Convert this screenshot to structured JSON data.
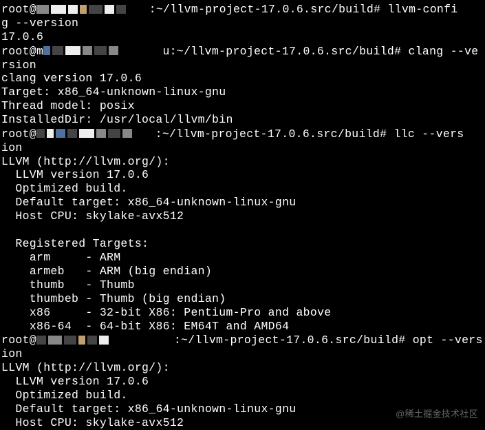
{
  "lines": {
    "l1a": "root@",
    "l1b": ":~/llvm-project-17.0.6.src/build# llvm-confi",
    "l2": "g --version",
    "l3": "17.0.6",
    "l4a": "root@m",
    "l4b": "u:~/llvm-project-17.0.6.src/build# clang --ve",
    "l5": "rsion",
    "l6": "clang version 17.0.6",
    "l7": "Target: x86_64-unknown-linux-gnu",
    "l8": "Thread model: posix",
    "l9": "InstalledDir: /usr/local/llvm/bin",
    "l10a": "root@",
    "l10b": ":~/llvm-project-17.0.6.src/build# llc --vers",
    "l11": "ion",
    "l12": "LLVM (http://llvm.org/):",
    "l13": "  LLVM version 17.0.6",
    "l14": "  Optimized build.",
    "l15": "  Default target: x86_64-unknown-linux-gnu",
    "l16": "  Host CPU: skylake-avx512",
    "l17": "",
    "l18": "  Registered Targets:",
    "l19": "    arm     - ARM",
    "l20": "    armeb   - ARM (big endian)",
    "l21": "    thumb   - Thumb",
    "l22": "    thumbeb - Thumb (big endian)",
    "l23": "    x86     - 32-bit X86: Pentium-Pro and above",
    "l24": "    x86-64  - 64-bit X86: EM64T and AMD64",
    "l25a": "root@",
    "l25b": ":~/llvm-project-17.0.6.src/build# opt --vers",
    "l26": "ion",
    "l27": "LLVM (http://llvm.org/):",
    "l28": "  LLVM version 17.0.6",
    "l29": "  Optimized build.",
    "l30": "  Default target: x86_64-unknown-linux-gnu",
    "l31": "  Host CPU: skylake-avx512"
  },
  "watermark": "@稀土掘金技术社区"
}
